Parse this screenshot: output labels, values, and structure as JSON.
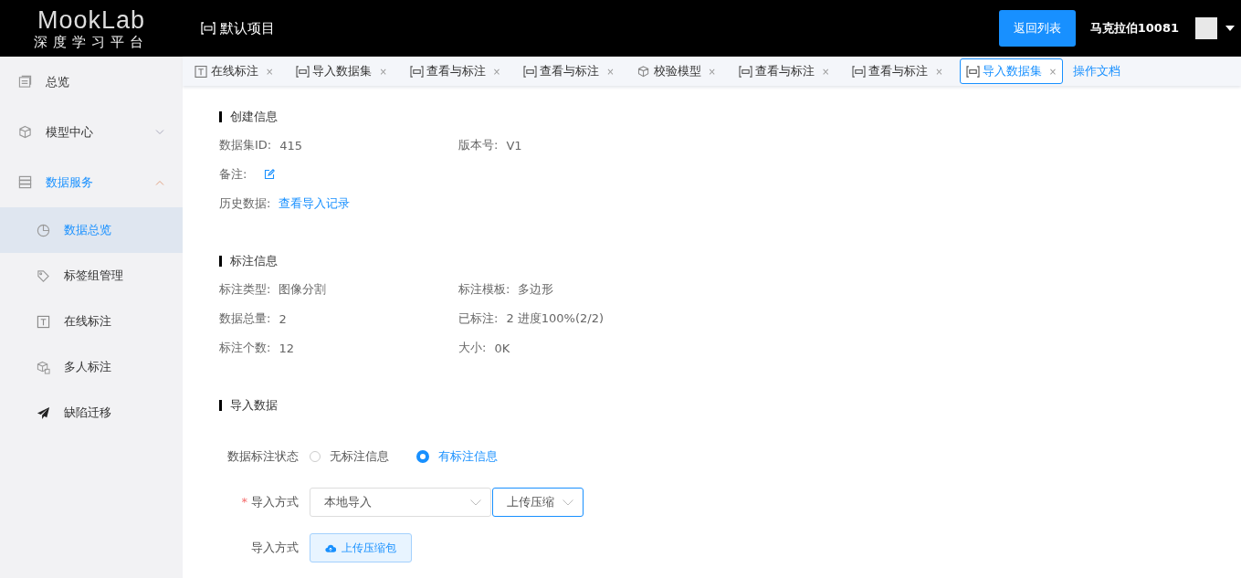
{
  "header": {
    "logo_title": "MookLab",
    "logo_subtitle": "深度学习平台",
    "project": "默认项目",
    "back_button": "返回列表",
    "user_name": "马克拉伯10081"
  },
  "sidebar": {
    "items": [
      {
        "label": "总览",
        "kind": "overview",
        "selected": false
      },
      {
        "label": "模型中心",
        "kind": "cube",
        "selected": false,
        "expanded": false
      },
      {
        "label": "数据服务",
        "kind": "list",
        "selected": true,
        "expanded": true,
        "children": [
          {
            "label": "数据总览",
            "kind": "pie",
            "selected": true
          },
          {
            "label": "标签组管理",
            "kind": "tag",
            "selected": false
          },
          {
            "label": "在线标注",
            "kind": "text",
            "selected": false
          },
          {
            "label": "多人标注",
            "kind": "cubes",
            "selected": false
          },
          {
            "label": "缺陷迁移",
            "kind": "plane",
            "selected": false
          }
        ]
      }
    ]
  },
  "tabs": [
    {
      "label": "在线标注",
      "kind": "text",
      "selected": false,
      "close": "×"
    },
    {
      "label": "导入数据集",
      "kind": "frame",
      "selected": false,
      "close": "×"
    },
    {
      "label": "查看与标注",
      "kind": "frame",
      "selected": false,
      "close": "×"
    },
    {
      "label": "查看与标注",
      "kind": "frame",
      "selected": false,
      "close": "×"
    },
    {
      "label": "校验模型",
      "kind": "cube",
      "selected": false,
      "close": "×"
    },
    {
      "label": "查看与标注",
      "kind": "frame",
      "selected": false,
      "close": "×"
    },
    {
      "label": "查看与标注",
      "kind": "frame",
      "selected": false,
      "close": "×"
    },
    {
      "label": "导入数据集",
      "kind": "frame",
      "selected": true,
      "close": "×"
    }
  ],
  "docs_link": "操作文档",
  "sections": [
    {
      "title": "创建信息",
      "rows": [
        [
          {
            "label": "数据集ID:",
            "value": "415",
            "kind": "text"
          },
          {
            "label": "版本号:",
            "value": "V1",
            "kind": "text"
          }
        ],
        [
          {
            "label": "备注:",
            "kind": "edit"
          }
        ],
        [
          {
            "label": "历史数据:",
            "value": "查看导入记录",
            "kind": "link"
          }
        ]
      ]
    },
    {
      "title": "标注信息",
      "rows": [
        [
          {
            "label": "标注类型:",
            "value": "图像分割",
            "kind": "text"
          },
          {
            "label": "标注模板:",
            "value": "多边形",
            "kind": "text"
          }
        ],
        [
          {
            "label": "数据总量:",
            "value": "2",
            "kind": "text"
          },
          {
            "label": "已标注:",
            "value": "2 进度100%(2/2)",
            "kind": "text"
          }
        ],
        [
          {
            "label": "标注个数:",
            "value": "12",
            "kind": "text"
          },
          {
            "label": "大小:",
            "value": "0K",
            "kind": "text"
          }
        ]
      ]
    },
    {
      "title": "导入数据"
    }
  ],
  "form": {
    "status": {
      "label": "数据标注状态",
      "options": [
        {
          "label": "无标注信息",
          "selected": false
        },
        {
          "label": "有标注信息",
          "selected": true
        }
      ]
    },
    "method": {
      "label": "导入方式",
      "required_mark": "*",
      "select1": "本地导入",
      "select2": "上传压缩"
    },
    "upload": {
      "label": "导入方式",
      "button": "上传压缩包"
    }
  }
}
